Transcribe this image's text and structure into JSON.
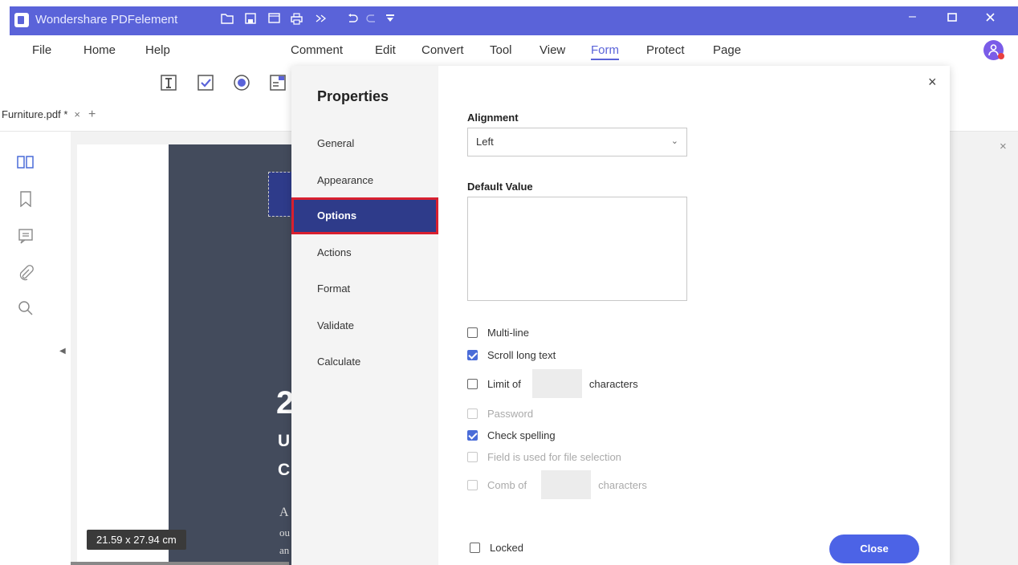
{
  "titlebar": {
    "app_title": "Wondershare PDFelement",
    "icons": [
      "app-logo",
      "folder-icon",
      "save-icon",
      "mail-icon",
      "print-icon",
      "share-icon",
      "undo-icon",
      "redo-icon",
      "dropdown-arrow-icon"
    ],
    "window_controls": [
      "minimize",
      "maximize",
      "close"
    ],
    "color": "#5a63d9"
  },
  "menu": {
    "items": [
      "File",
      "Home",
      "Help",
      "Comment",
      "Edit",
      "Convert",
      "Tool",
      "View",
      "Form",
      "Protect",
      "Page"
    ],
    "active": "Form"
  },
  "toolbar": {
    "icons": [
      "text-field-icon",
      "checkbox-icon",
      "radio-button-icon",
      "list-box-icon"
    ]
  },
  "tab": {
    "label": "Furniture.pdf *",
    "close": "×",
    "add": "+"
  },
  "sidebar": {
    "icons": [
      "thumbnails-icon",
      "bookmark-icon",
      "comment-icon",
      "attachment-icon",
      "search-icon"
    ]
  },
  "document": {
    "page_size": "21.59 x 27.94 cm",
    "page_text": {
      "big_num": "2",
      "line_u": "U",
      "line_c": "C",
      "para_a": "A",
      "para_o": "ou",
      "para_an": "an"
    }
  },
  "properties": {
    "title": "Properties",
    "close_x": "×",
    "nav": [
      "General",
      "Appearance",
      "Options",
      "Actions",
      "Format",
      "Validate",
      "Calculate"
    ],
    "selected_nav": "Options",
    "alignment_label": "Alignment",
    "alignment_value": "Left",
    "default_value_label": "Default Value",
    "default_value": "",
    "options": {
      "multiline": {
        "label": "Multi-line",
        "checked": false,
        "enabled": true
      },
      "scroll_long_text": {
        "label": "Scroll long text",
        "checked": true,
        "enabled": true
      },
      "limit_of": {
        "label": "Limit of",
        "suffix": "characters",
        "checked": false,
        "enabled": true
      },
      "password": {
        "label": "Password",
        "checked": false,
        "enabled": false
      },
      "check_spelling": {
        "label": "Check spelling",
        "checked": true,
        "enabled": true
      },
      "file_selection": {
        "label": "Field is used for file selection",
        "checked": false,
        "enabled": false
      },
      "comb_of": {
        "label": "Comb of",
        "suffix": "characters",
        "checked": false,
        "enabled": false
      }
    },
    "locked_label": "Locked",
    "close_button": "Close",
    "accent": "#4c63e6",
    "selected_nav_bg": "#2e3b8a",
    "highlight": "#d8202f"
  },
  "panel_close": "×"
}
